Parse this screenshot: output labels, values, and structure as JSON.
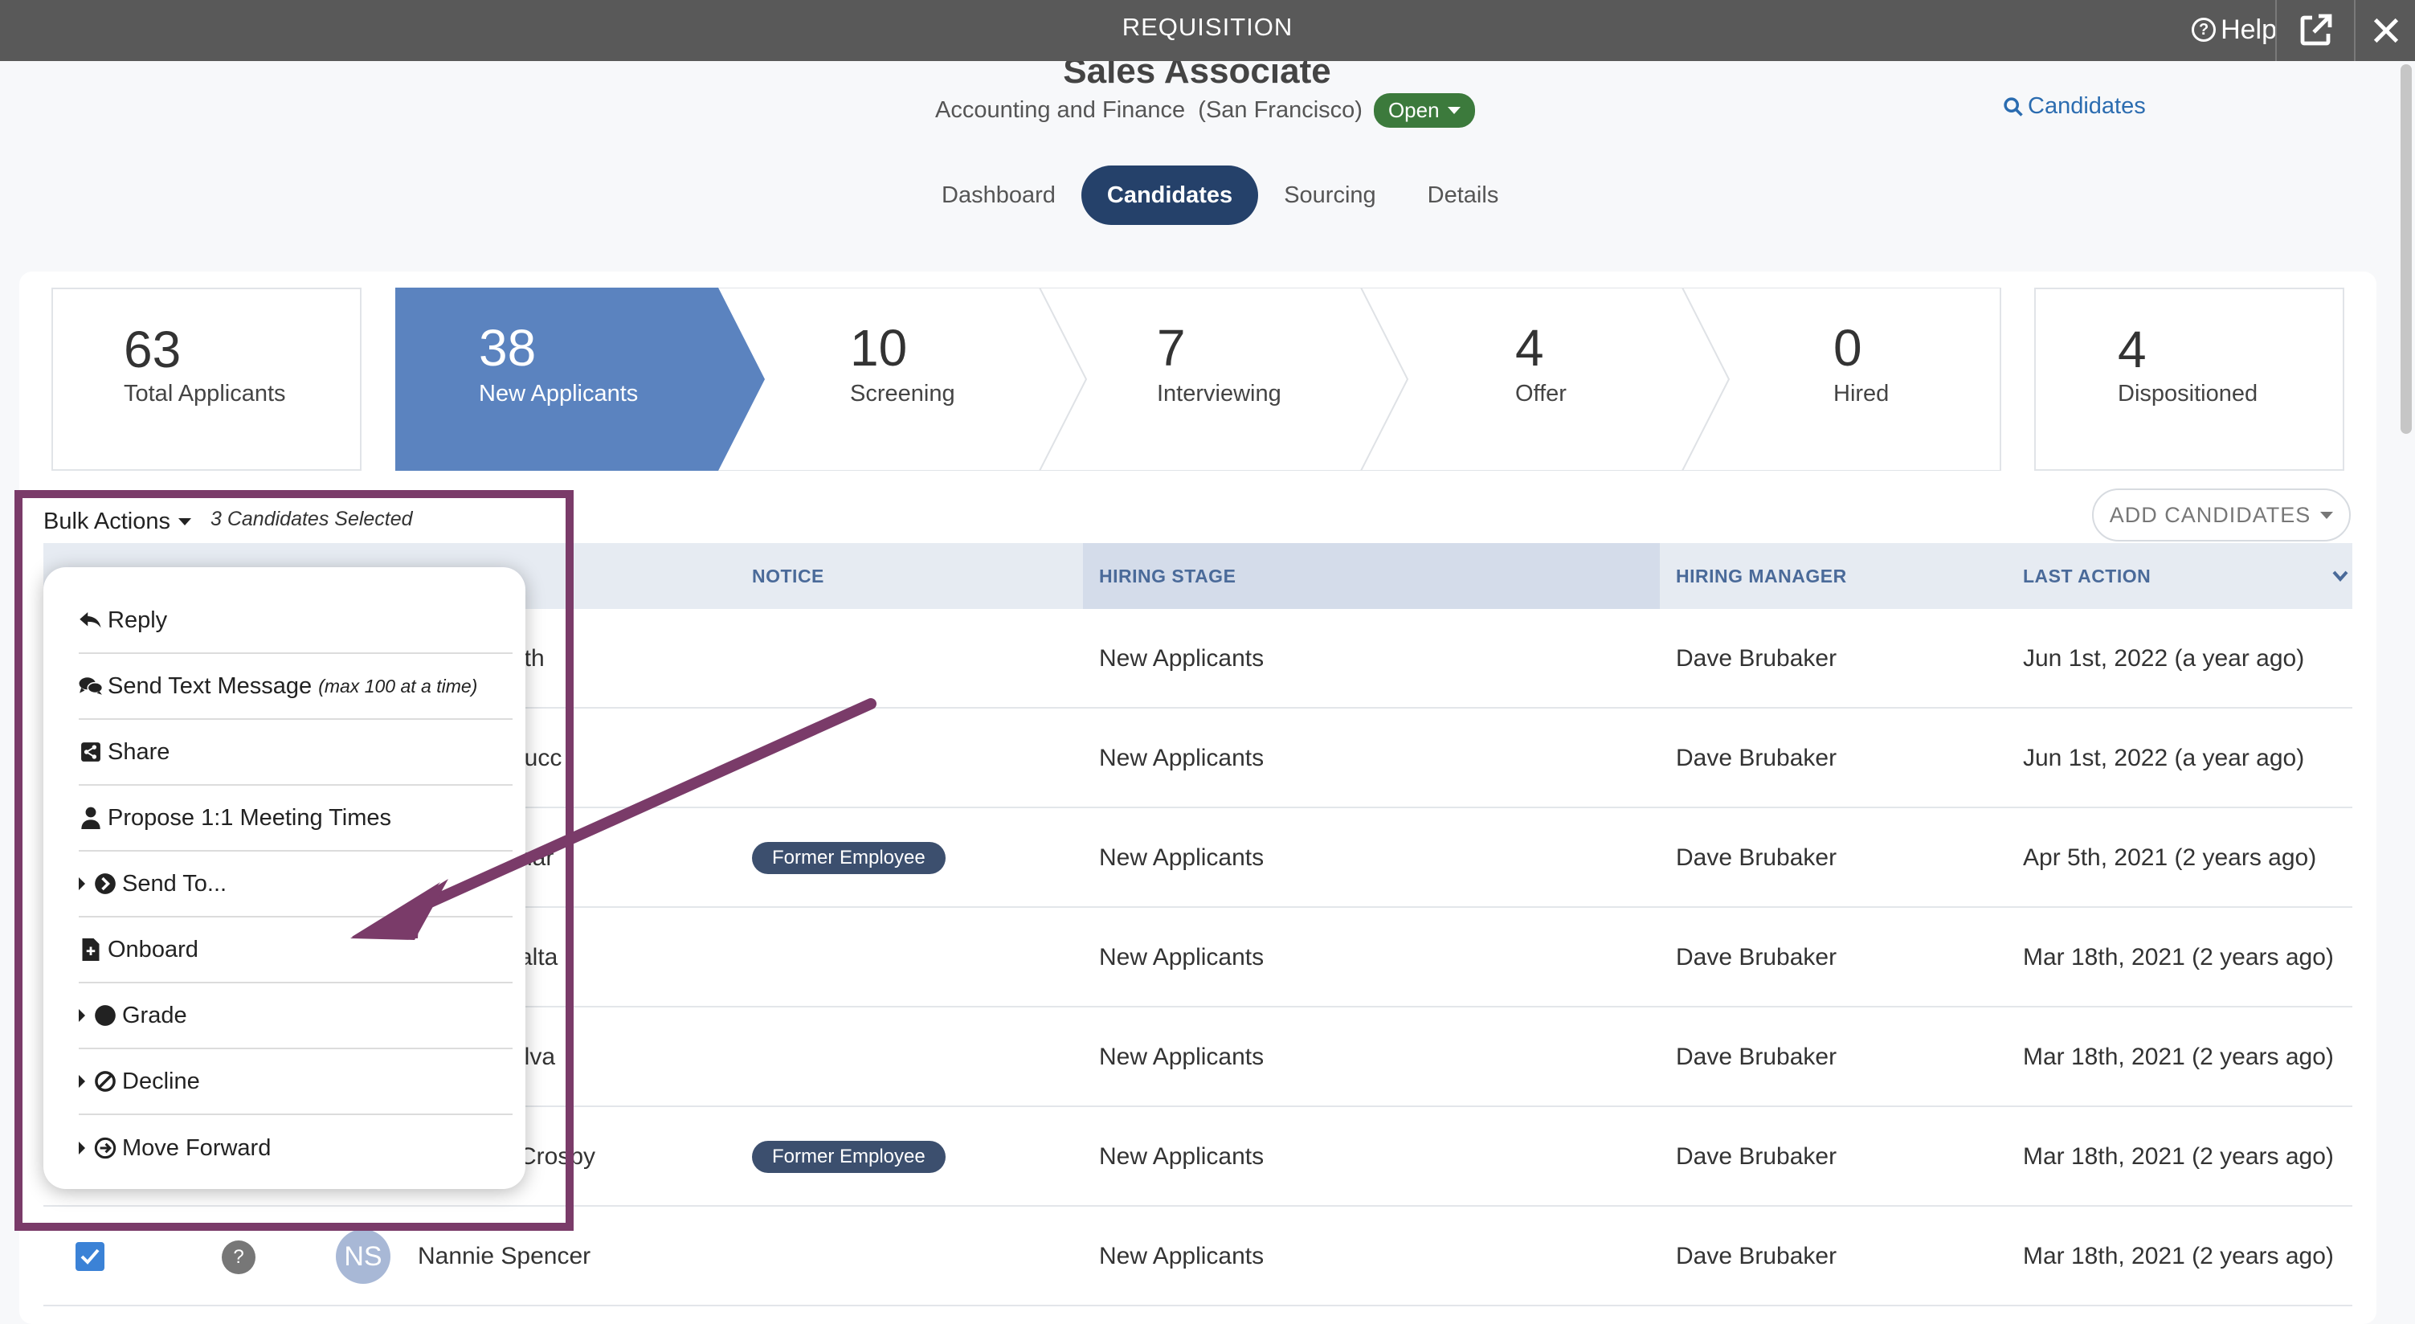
{
  "window": {
    "title": "REQUISITION",
    "help_label": "Help"
  },
  "job": {
    "title": "Sales Associate",
    "department": "Accounting and Finance",
    "location": "(San Francisco)",
    "status": "Open",
    "search_link": "Candidates"
  },
  "tabs": [
    {
      "label": "Dashboard",
      "active": false
    },
    {
      "label": "Candidates",
      "active": true
    },
    {
      "label": "Sourcing",
      "active": false
    },
    {
      "label": "Details",
      "active": false
    }
  ],
  "stats": {
    "total": {
      "count": "63",
      "label": "Total Applicants"
    },
    "stages": [
      {
        "count": "38",
        "label": "New Applicants",
        "active": true
      },
      {
        "count": "10",
        "label": "Screening",
        "active": false
      },
      {
        "count": "7",
        "label": "Interviewing",
        "active": false
      },
      {
        "count": "4",
        "label": "Offer",
        "active": false
      },
      {
        "count": "0",
        "label": "Hired",
        "active": false
      }
    ],
    "dispositioned": {
      "count": "4",
      "label": "Dispositioned"
    }
  },
  "toolbar": {
    "bulk_actions": "Bulk Actions",
    "selected_count": "3 Candidates Selected",
    "add_candidates": "ADD CANDIDATES"
  },
  "table": {
    "columns": {
      "notice": "NOTICE",
      "hiring_stage": "HIRING STAGE",
      "hiring_manager": "HIRING MANAGER",
      "last_action": "LAST ACTION"
    },
    "rows": [
      {
        "name_fragment": "ith",
        "notice": "",
        "stage": "New Applicants",
        "manager": "Dave Brubaker",
        "last_action": "Jun 1st, 2022 (a year ago)"
      },
      {
        "name_fragment": "lucc",
        "notice": "",
        "stage": "New Applicants",
        "manager": "Dave Brubaker",
        "last_action": "Jun 1st, 2022 (a year ago)"
      },
      {
        "name_fragment": "har",
        "notice": "Former Employee",
        "stage": "New Applicants",
        "manager": "Dave Brubaker",
        "last_action": "Apr 5th, 2021 (2 years ago)"
      },
      {
        "name_fragment": "alta",
        "notice": "",
        "stage": "New Applicants",
        "manager": "Dave Brubaker",
        "last_action": "Mar 18th, 2021 (2 years ago)"
      },
      {
        "name_fragment": "ilva",
        "notice": "",
        "stage": "New Applicants",
        "manager": "Dave Brubaker",
        "last_action": "Mar 18th, 2021 (2 years ago)"
      },
      {
        "name_fragment": "Crosby",
        "notice": "Former Employee",
        "stage": "New Applicants",
        "manager": "Dave Brubaker",
        "last_action": "Mar 18th, 2021 (2 years ago)"
      },
      {
        "name_fragment": "Nannie Spencer",
        "initials": "NS",
        "notice": "",
        "stage": "New Applicants",
        "manager": "Dave Brubaker",
        "last_action": "Mar 18th, 2021 (2 years ago)"
      }
    ]
  },
  "bulk_menu": {
    "items": [
      {
        "label": "Reply",
        "icon": "reply-icon",
        "submenu": false
      },
      {
        "label": "Send Text Message",
        "note": "(max 100 at a time)",
        "icon": "chat-icon",
        "submenu": false
      },
      {
        "label": "Share",
        "icon": "share-icon",
        "submenu": false
      },
      {
        "label": "Propose 1:1 Meeting Times",
        "icon": "user-icon",
        "submenu": false
      },
      {
        "label": "Send To...",
        "icon": "arrow-circle-icon",
        "submenu": true
      },
      {
        "label": "Onboard",
        "icon": "document-icon",
        "submenu": false
      },
      {
        "label": "Grade",
        "icon": "circle-icon",
        "submenu": true
      },
      {
        "label": "Decline",
        "icon": "ban-icon",
        "submenu": true
      },
      {
        "label": "Move Forward",
        "icon": "arrow-right-circle-icon",
        "submenu": true
      }
    ]
  },
  "colors": {
    "topbar": "#595959",
    "active_stage": "#5b83bf",
    "active_tab": "#25416a",
    "status_open": "#3c7a3c",
    "highlight": "#7a3b69"
  }
}
